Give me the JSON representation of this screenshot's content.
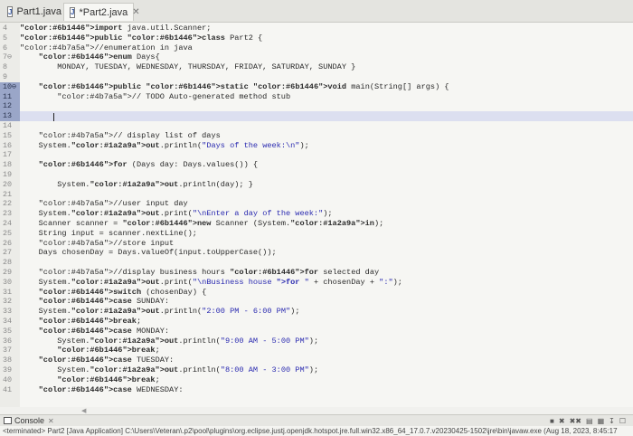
{
  "tabs": [
    {
      "label": "Part1.java",
      "active": false
    },
    {
      "label": "*Part2.java",
      "active": true
    }
  ],
  "editor": {
    "lines": [
      {
        "num": "4",
        "text": "import java.util.Scanner;"
      },
      {
        "num": "5",
        "text": "public class Part2 {"
      },
      {
        "num": "6",
        "text": "//enumeration in java"
      },
      {
        "num": "7⊖",
        "text": "    enum Days{"
      },
      {
        "num": "8",
        "text": "        MONDAY, TUESDAY, WEDNESDAY, THURSDAY, FRIDAY, SATURDAY, SUNDAY }"
      },
      {
        "num": "9",
        "text": ""
      },
      {
        "num": "10⊖",
        "text": "    public static void main(String[] args) {"
      },
      {
        "num": "11",
        "text": "        // TODO Auto-generated method stub"
      },
      {
        "num": "12",
        "text": ""
      },
      {
        "num": "13",
        "text": ""
      },
      {
        "num": "14",
        "text": ""
      },
      {
        "num": "15",
        "text": "    // display list of days"
      },
      {
        "num": "16",
        "text": "    System.out.println(\"Days of the week:\\n\");"
      },
      {
        "num": "17",
        "text": ""
      },
      {
        "num": "18",
        "text": "    for (Days day: Days.values()) {"
      },
      {
        "num": "19",
        "text": ""
      },
      {
        "num": "20",
        "text": "        System.out.println(day); }"
      },
      {
        "num": "21",
        "text": ""
      },
      {
        "num": "22",
        "text": "    //user input day"
      },
      {
        "num": "23",
        "text": "    System.out.print(\"\\nEnter a day of the week:\");"
      },
      {
        "num": "24",
        "text": "    Scanner scanner = new Scanner (System.in);"
      },
      {
        "num": "25",
        "text": "    String input = scanner.nextLine();"
      },
      {
        "num": "26",
        "text": "    //store input"
      },
      {
        "num": "27",
        "text": "    Days chosenDay = Days.valueOf(input.toUpperCase());"
      },
      {
        "num": "28",
        "text": ""
      },
      {
        "num": "29",
        "text": "    //display business hours for selected day"
      },
      {
        "num": "30",
        "text": "    System.out.print(\"\\nBusiness house for \" + chosenDay + \":\");"
      },
      {
        "num": "31",
        "text": "    switch (chosenDay) {"
      },
      {
        "num": "32",
        "text": "    case SUNDAY:"
      },
      {
        "num": "33",
        "text": "    System.out.println(\"2:00 PM - 6:00 PM\");"
      },
      {
        "num": "34",
        "text": "    break;"
      },
      {
        "num": "35",
        "text": "    case MONDAY:"
      },
      {
        "num": "36",
        "text": "        System.out.println(\"9:00 AM - 5:00 PM\");"
      },
      {
        "num": "37",
        "text": "        break;"
      },
      {
        "num": "38",
        "text": "    case TUESDAY:"
      },
      {
        "num": "39",
        "text": "        System.out.println(\"8:00 AM - 3:00 PM\");"
      },
      {
        "num": "40",
        "text": "        break;"
      },
      {
        "num": "41",
        "text": "    case WEDNESDAY:"
      }
    ]
  },
  "console": {
    "label": "Console",
    "tab_close": "✕",
    "status": "<terminated> Part2 [Java Application] C:\\Users\\Veteran\\.p2\\pool\\plugins\\org.eclipse.justj.openjdk.hotspot.jre.full.win32.x86_64_17.0.7.v20230425-1502\\jre\\bin\\javaw.exe (Aug 18, 2023, 8:45:17"
  },
  "icons": {
    "tab_close": "✕",
    "console_tools": [
      "■",
      "✖",
      "✖✖",
      "▤",
      "▦",
      "↧",
      "☐"
    ]
  }
}
